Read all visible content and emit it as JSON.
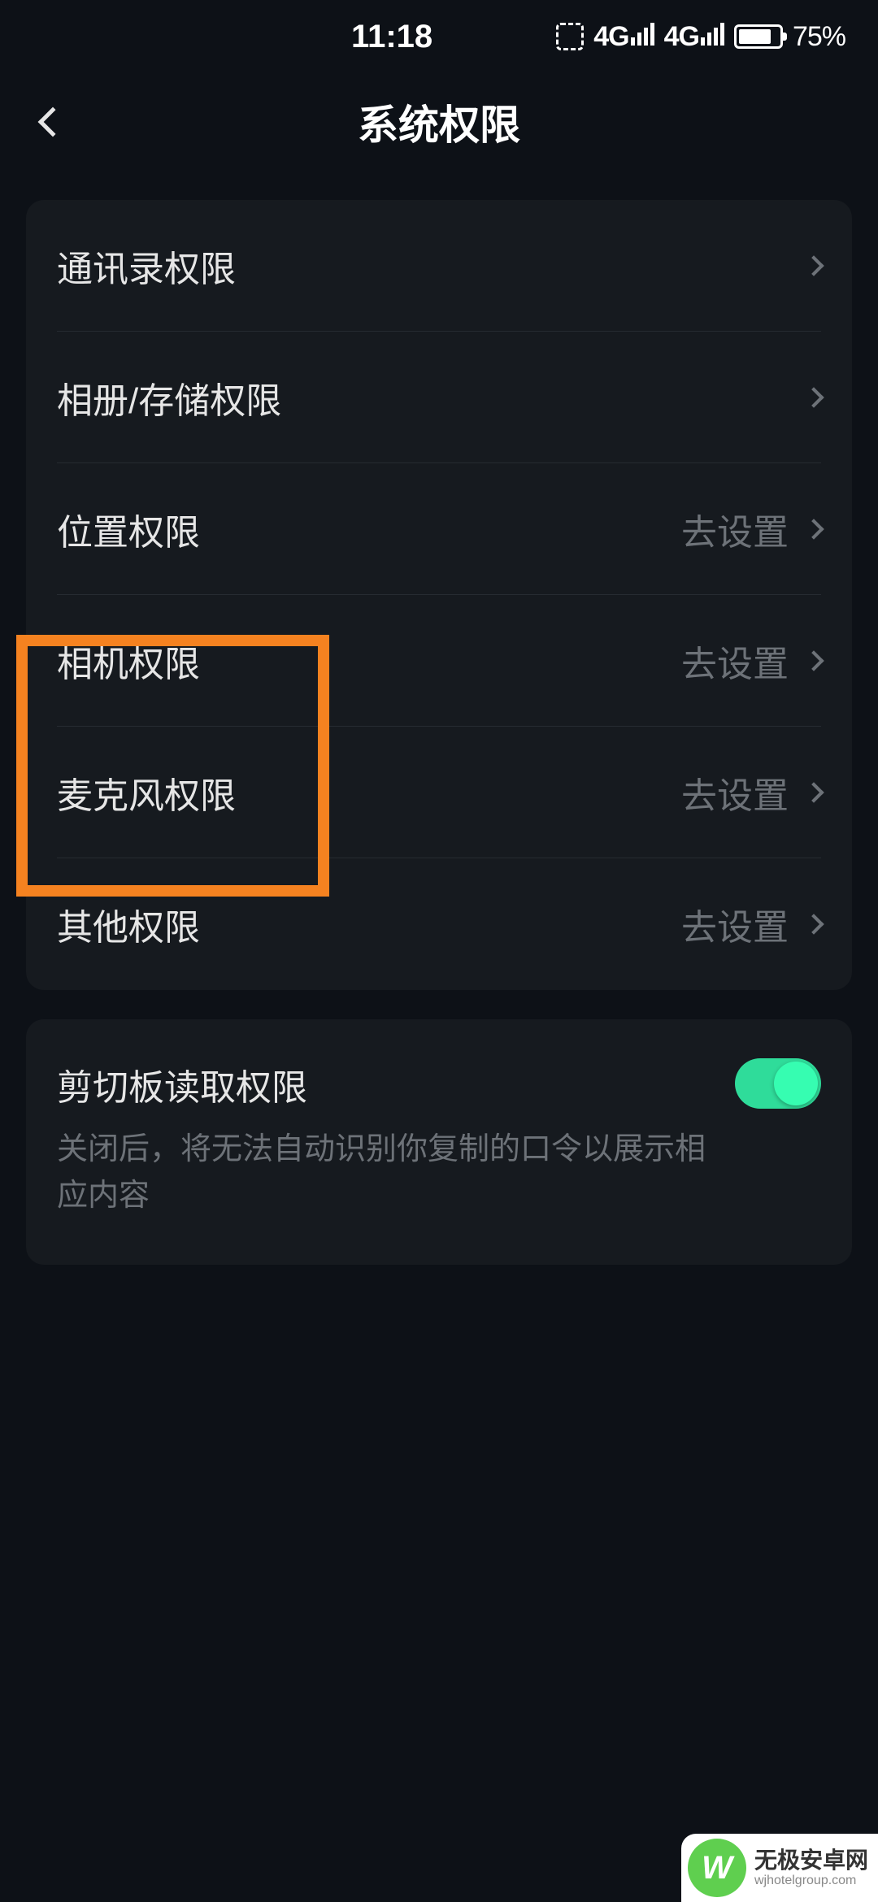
{
  "statusBar": {
    "time": "11:18",
    "signal1_label": "4G",
    "signal2_label": "4G",
    "battery_pct": "75%"
  },
  "header": {
    "title": "系统权限"
  },
  "permissions": [
    {
      "label": "通讯录权限",
      "action": ""
    },
    {
      "label": "相册/存储权限",
      "action": ""
    },
    {
      "label": "位置权限",
      "action": "去设置"
    },
    {
      "label": "相机权限",
      "action": "去设置"
    },
    {
      "label": "麦克风权限",
      "action": "去设置"
    },
    {
      "label": "其他权限",
      "action": "去设置"
    }
  ],
  "clipboard": {
    "title": "剪切板读取权限",
    "desc": "关闭后，将无法自动识别你复制的口令以展示相应内容",
    "enabled": true
  },
  "watermark": {
    "logo_text": "W",
    "title": "无极安卓网",
    "sub": "wjhotelgroup.com"
  }
}
